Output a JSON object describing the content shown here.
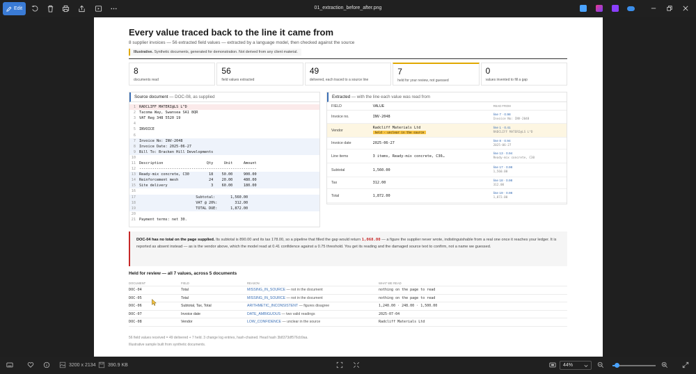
{
  "viewer": {
    "edit_label": "Edit",
    "filename": "01_extraction_before_after.png",
    "dimensions": "3200 x 2134",
    "file_size": "390.9 KB",
    "zoom": "44%",
    "zoom_fraction": 0.1
  },
  "doc": {
    "title": "Every value traced back to the line it came from",
    "subtitle": "8 supplier invoices — 56 extracted field values — extracted by a language model, then checked against the source",
    "disclaimer_bold": "Illustrative.",
    "disclaimer_text": "Synthetic documents, generated for demonstration. Not derived from any client material.",
    "stats": [
      {
        "num": "8",
        "label": "documents read"
      },
      {
        "num": "56",
        "label": "field values extracted"
      },
      {
        "num": "49",
        "label": "delivered, each traced to a source line"
      },
      {
        "num": "7",
        "label": "held for your review, not guessed"
      },
      {
        "num": "0",
        "label": "values invented to fill a gap"
      }
    ],
    "source": {
      "title": "Source document",
      "title_muted": "— DOC-08, as supplied",
      "lines": [
        {
          "n": "1",
          "t": "RADCLIFF MATERI@LS L^D"
        },
        {
          "n": "2",
          "t": "Tacoma Way, Swansea SA1 8QR"
        },
        {
          "n": "3",
          "t": "VAT Reg 348 5520 19"
        },
        {
          "n": "4",
          "t": ""
        },
        {
          "n": "5",
          "t": "INVOICE"
        },
        {
          "n": "6",
          "t": ""
        },
        {
          "n": "7",
          "t": "Invoice No: INV-2048"
        },
        {
          "n": "8",
          "t": "Invoice Date: 2025-06-27"
        },
        {
          "n": "9",
          "t": "Bill To: Bracken Hill Developments"
        },
        {
          "n": "10",
          "t": ""
        },
        {
          "n": "11",
          "t": "Description                    Qty     Unit     Amount"
        },
        {
          "n": "12",
          "t": "------------------------------------------------------"
        },
        {
          "n": "13",
          "t": "Ready-mix concrete, C30         18    50.00     900.00"
        },
        {
          "n": "14",
          "t": "Reinforcement mesh              24    20.00     480.00"
        },
        {
          "n": "15",
          "t": "Site delivery                    3    60.00     180.00"
        },
        {
          "n": "16",
          "t": ""
        },
        {
          "n": "17",
          "t": "                          Subtotal:       1,560.00"
        },
        {
          "n": "18",
          "t": "                          VAT @ 20%:        312.00"
        },
        {
          "n": "19",
          "t": "                          TOTAL DUE:      1,872.00"
        },
        {
          "n": "20",
          "t": ""
        },
        {
          "n": "21",
          "t": "Payment terms: net 30."
        }
      ]
    },
    "extracted": {
      "title": "Extracted",
      "title_muted": "— with the line each value was read from",
      "col_field": "FIELD",
      "col_value": "VALUE",
      "col_read": "READ FROM",
      "rows": [
        {
          "field": "Invoice no.",
          "value": "INV-2048",
          "read": "line 7 · 0.98",
          "raw": "Invoice No: INV-2048"
        },
        {
          "field": "Vendor",
          "value": "Radcliff Materials Ltd",
          "tag": "held · unclear in the source",
          "read": "line 1 · 0.41",
          "raw": "RADCLIFF MATERI@LS L^D"
        },
        {
          "field": "Invoice date",
          "value": "2025-06-27",
          "read": "line 8 · 0.94",
          "raw": "2025-06-27"
        },
        {
          "field": "Line items",
          "value": "3 items, Ready-mix concrete, C30…",
          "read": "line 13 · 0.94",
          "raw": "Ready-mix concrete, C30"
        },
        {
          "field": "Subtotal",
          "value": "1,560.00",
          "read": "line 17 · 0.98",
          "raw": "1,560.00"
        },
        {
          "field": "Tax",
          "value": "312.00",
          "read": "line 18 · 0.98",
          "raw": "312.00"
        },
        {
          "field": "Total",
          "value": "1,872.00",
          "read": "line 19 · 0.98",
          "raw": "1,872.00"
        }
      ]
    },
    "callout": {
      "bold": "DOC-04 has no total on the page supplied.",
      "text1": "Its subtotal is 890.00 and its tax 178.00, so a pipeline that filled the gap would return",
      "amount": "1,068.00",
      "text2": "— a figure the supplier never wrote, indistinguishable from a real one once it reaches your ledger. It is reported as absent instead — as is the vendor above, which the model read at 0.41 confidence against a 0.75 threshold. You get its reading and the damaged source text to confirm, not a name we guessed."
    },
    "held": {
      "title": "Held for review — all 7 values, across 5 documents",
      "col_doc": "DOCUMENT",
      "col_field": "FIELD",
      "col_reason": "REASON",
      "col_read": "WHAT WE READ",
      "rows": [
        {
          "doc": "DOC-04",
          "field": "Total",
          "code": "MISSING_IN_SOURCE",
          "why": "— not in the document",
          "read": "nothing on the page to read"
        },
        {
          "doc": "DOC-05",
          "field": "Total",
          "code": "MISSING_IN_SOURCE",
          "why": "— not in the document",
          "read": "nothing on the page to read"
        },
        {
          "doc": "DOC-06",
          "field": "Subtotal, Tax, Total",
          "code": "ARITHMETIC_INCONSISTENT",
          "why": "— figures disagree",
          "read": "1,240.00 · 248.00 · 1,500.00"
        },
        {
          "doc": "DOC-07",
          "field": "Invoice date",
          "code": "DATE_AMBIGUOUS",
          "why": "— two valid readings",
          "read": "2025-07-04"
        },
        {
          "doc": "DOC-08",
          "field": "Vendor",
          "code": "LOW_CONFIDENCE",
          "why": "— unclear in the source",
          "read": "Radcliff Materials Ltd"
        }
      ]
    },
    "footer1": "56 field values received = 49 delivered + 7 held. 3 change log entries, hash-chained. Head hash 3b8373df576cb9aa.",
    "footer2": "Illustrative sample built from synthetic documents."
  }
}
